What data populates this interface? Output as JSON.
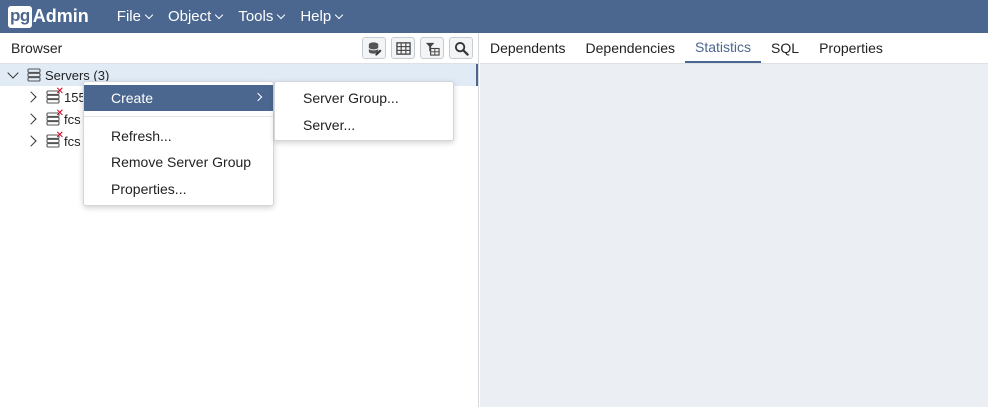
{
  "app": {
    "logo_pg": "pg",
    "logo_admin": "Admin",
    "menu": [
      {
        "label": "File"
      },
      {
        "label": "Object"
      },
      {
        "label": "Tools"
      },
      {
        "label": "Help"
      }
    ],
    "navbar_color": "#4b6790"
  },
  "browser": {
    "title": "Browser",
    "toolbar": [
      {
        "icon": "query-tool-icon"
      },
      {
        "icon": "view-data-icon"
      },
      {
        "icon": "filtered-rows-icon"
      },
      {
        "icon": "search-icon"
      }
    ],
    "tree": {
      "root_label": "Servers (3)",
      "children": [
        {
          "label": "155"
        },
        {
          "label": "fcs"
        },
        {
          "label": "fcs"
        }
      ]
    }
  },
  "tabs": [
    {
      "label": "Dependents",
      "active": false
    },
    {
      "label": "Dependencies",
      "active": false
    },
    {
      "label": "Statistics",
      "active": true
    },
    {
      "label": "SQL",
      "active": false
    },
    {
      "label": "Properties",
      "active": false
    }
  ],
  "context_menu": {
    "items": [
      {
        "label": "Create",
        "active": true,
        "has_submenu": true
      },
      {
        "label": "Refresh..."
      },
      {
        "label": "Remove Server Group"
      },
      {
        "label": "Properties..."
      }
    ],
    "submenu": [
      {
        "label": "Server Group..."
      },
      {
        "label": "Server..."
      }
    ]
  }
}
